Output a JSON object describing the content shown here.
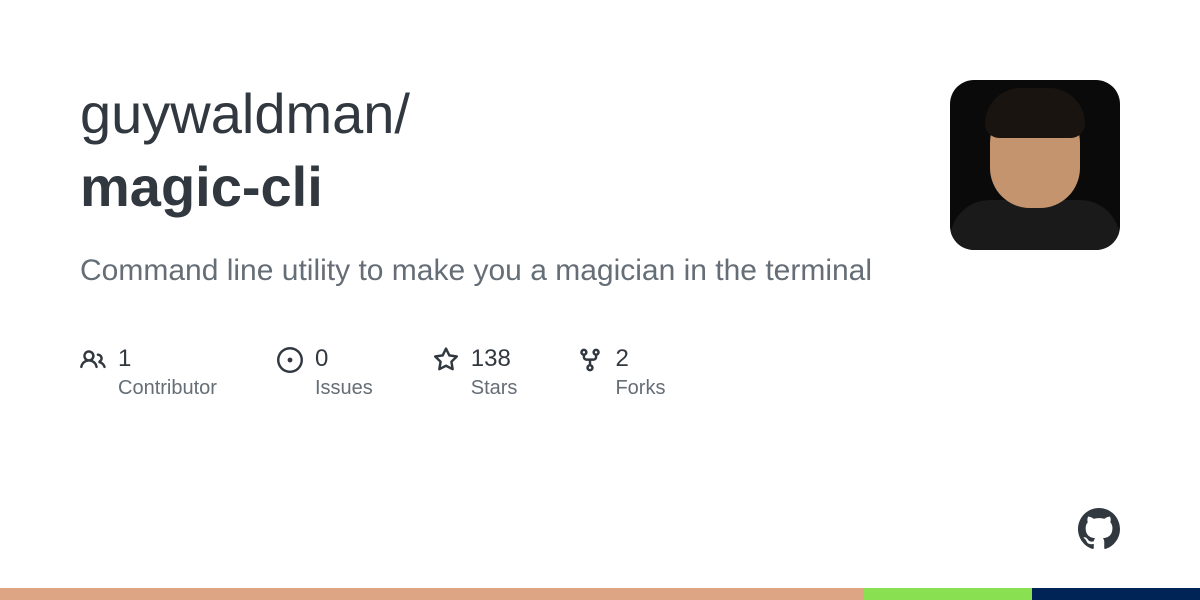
{
  "repo": {
    "owner": "guywaldman",
    "name": "magic-cli",
    "description": "Command line utility to make you a magician in the terminal"
  },
  "stats": {
    "contributors": {
      "count": "1",
      "label": "Contributor"
    },
    "issues": {
      "count": "0",
      "label": "Issues"
    },
    "stars": {
      "count": "138",
      "label": "Stars"
    },
    "forks": {
      "count": "2",
      "label": "Forks"
    }
  },
  "colors": {
    "lang1": "#dea584",
    "lang2": "#89e051",
    "lang3": "#012456"
  }
}
